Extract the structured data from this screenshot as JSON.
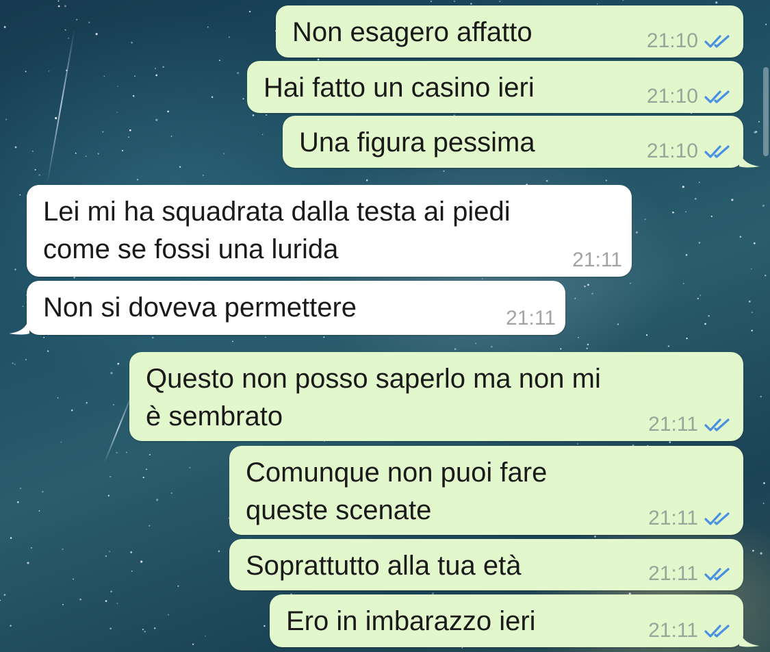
{
  "colors": {
    "outgoing_bubble": "#e2f7cb",
    "incoming_bubble": "#ffffff",
    "read_ticks": "#4a90e2",
    "timestamp": "#9aa59a"
  },
  "messages": [
    {
      "direction": "out",
      "text": "Non esagero affatto",
      "time": "21:10",
      "status_icon": "double-check-read-icon"
    },
    {
      "direction": "out",
      "text": "Hai fatto un casino ieri",
      "time": "21:10",
      "status_icon": "double-check-read-icon"
    },
    {
      "direction": "out",
      "text": "Una figura pessima",
      "time": "21:10",
      "status_icon": "double-check-read-icon"
    },
    {
      "direction": "in",
      "text": "Lei mi ha squadrata dalla testa ai piedi\ncome se fossi una lurida",
      "time": "21:11"
    },
    {
      "direction": "in",
      "text": "Non si doveva permettere",
      "time": "21:11"
    },
    {
      "direction": "out",
      "text": "Questo non posso saperlo ma non mi\nè sembrato",
      "time": "21:11",
      "status_icon": "double-check-read-icon"
    },
    {
      "direction": "out",
      "text": "Comunque non puoi fare\nqueste scenate",
      "time": "21:11",
      "status_icon": "double-check-read-icon"
    },
    {
      "direction": "out",
      "text": "Soprattutto alla tua età",
      "time": "21:11",
      "status_icon": "double-check-read-icon"
    },
    {
      "direction": "out",
      "text": "Ero in imbarazzo ieri",
      "time": "21:11",
      "status_icon": "double-check-read-icon"
    }
  ]
}
